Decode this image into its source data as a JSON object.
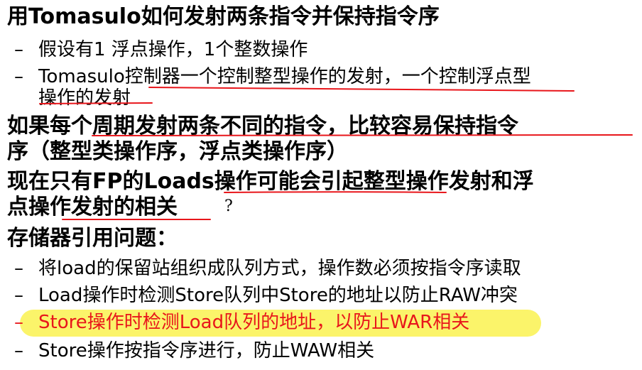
{
  "slide": {
    "title": "用Tomasulo如何发射两条指令并保持指令序",
    "bullets_1": [
      "假设有1 浮点操作，1个整数操作",
      "Tomasulo控制器一个控制整型操作的发射，一个控制浮点型",
      "操作的发射"
    ],
    "para_2": [
      "如果每个周期发射两条不同的指令，比较容易保持指令",
      "序（整型类操作序，浮点类操作序）"
    ],
    "para_3": [
      "现在只有FP的Loads操作可能会引起整型操作发射和浮",
      "点操作发射的相关"
    ],
    "para_3_mark": "?",
    "heading_4": "存储器引用问题：",
    "bullets_4": [
      "将load的保留站组织成队列方式，操作数必须按指令序读取",
      "Load操作时检测Store队列中Store的地址以防止RAW冲突",
      "Store操作时检测Load队列的地址，以防止WAR相关",
      "Store操作按指令序进行，防止WAW相关"
    ],
    "dash": "–"
  },
  "colors": {
    "text": "#000000",
    "highlight_red": "#e8161b",
    "highlighter": "#fbf35a"
  }
}
